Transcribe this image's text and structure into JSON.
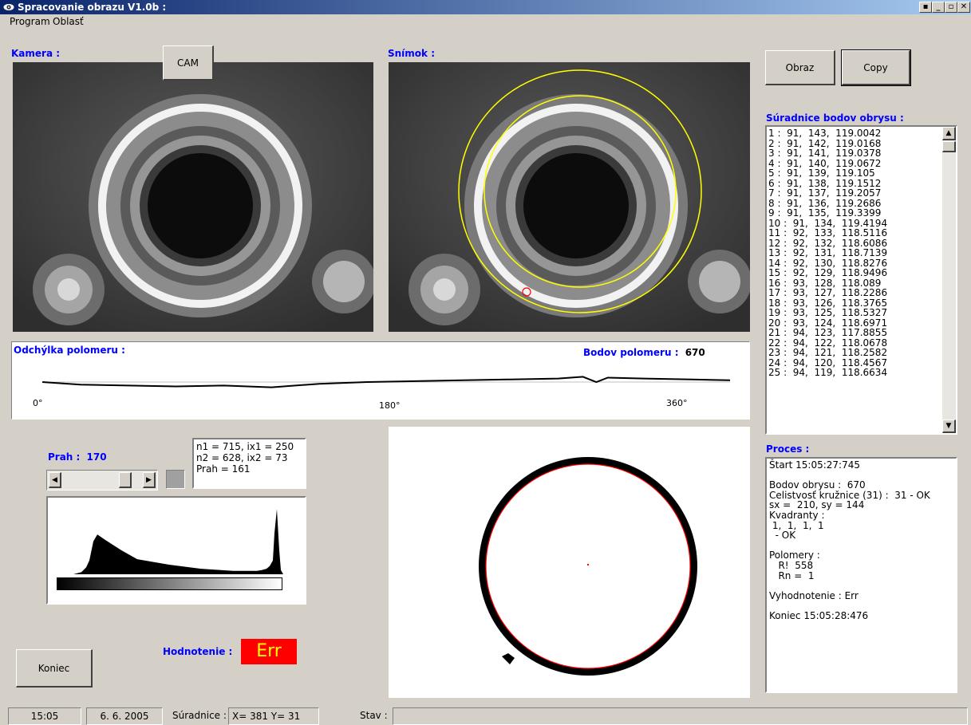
{
  "window": {
    "title": "Spracovanie obrazu V1.0b :",
    "controls": [
      "▪",
      "_",
      "▫",
      "✕"
    ]
  },
  "menu": {
    "items": [
      "Program",
      "Oblasť"
    ]
  },
  "camera": {
    "label": "Kamera :",
    "cam_button": "CAM"
  },
  "snapshot": {
    "label": "Snímok :"
  },
  "buttons": {
    "obraz": "Obraz",
    "copy": "Copy",
    "koniec": "Koniec"
  },
  "coords": {
    "label": "Súradnice bodov obrysu :",
    "items": [
      "1 :  91,  143,  119.0042",
      "2 :  91,  142,  119.0168",
      "3 :  91,  141,  119.0378",
      "4 :  91,  140,  119.0672",
      "5 :  91,  139,  119.105",
      "6 :  91,  138,  119.1512",
      "7 :  91,  137,  119.2057",
      "8 :  91,  136,  119.2686",
      "9 :  91,  135,  119.3399",
      "10 :  91,  134,  119.4194",
      "11 :  92,  133,  118.5116",
      "12 :  92,  132,  118.6086",
      "13 :  92,  131,  118.7139",
      "14 :  92,  130,  118.8276",
      "15 :  92,  129,  118.9496",
      "16 :  93,  128,  118.089",
      "17 :  93,  127,  118.2286",
      "18 :  93,  126,  118.3765",
      "19 :  93,  125,  118.5327",
      "20 :  93,  124,  118.6971",
      "21 :  94,  123,  117.8855",
      "22 :  94,  122,  118.0678",
      "23 :  94,  121,  118.2582",
      "24 :  94,  120,  118.4567",
      "25 :  94,  119,  118.6634"
    ]
  },
  "deviation": {
    "label": "Odchýlka polomeru :",
    "points_label": "Bodov polomeru :",
    "points_value": "670",
    "axis_ticks": [
      "0°",
      "180°",
      "360°"
    ]
  },
  "threshold": {
    "label": "Prah :",
    "value": "170",
    "stats": [
      "n1 = 715, ix1 = 250",
      "n2 = 628, ix2 = 73",
      "Prah = 161"
    ]
  },
  "evaluation": {
    "label": "Hodnotenie :",
    "result": "Err"
  },
  "process": {
    "label": "Proces :",
    "lines": [
      "Štart 15:05:27:745",
      "",
      "Bodov obrysu :  670",
      "Celistvosť kružnice (31) :  31 - OK",
      "sx =  210, sy = 144",
      "Kvadranty :",
      " 1,  1,  1,  1",
      "  - OK",
      "",
      "Polomery :",
      "   R!  558",
      "   Rn =  1",
      "",
      "Vyhodnotenie : Err",
      "",
      "Koniec 15:05:28:476"
    ]
  },
  "status": {
    "time": "15:05",
    "date": "6. 6. 2005",
    "coords_label": "Súradnice :",
    "coords_value": "X= 381 Y= 31",
    "state_label": "Stav :"
  },
  "colors": {
    "title_blue": "#0a246a",
    "label_blue": "#0000ff",
    "err_red": "#ff0000",
    "err_text": "#ffff00",
    "ring_yellow": "#ffff00",
    "contour_red": "#ff0000"
  },
  "chart_data": [
    {
      "type": "line",
      "x": [
        0,
        20,
        45,
        70,
        95,
        120,
        145,
        170,
        195,
        220,
        245,
        270,
        283,
        290,
        296,
        315,
        340,
        360
      ],
      "y": [
        0,
        -3,
        -4,
        -5,
        -4,
        -6,
        -2,
        0,
        1,
        2,
        3,
        4,
        6,
        0,
        5,
        4,
        3,
        2
      ],
      "xlim": [
        0,
        360
      ],
      "xticks": [
        "0°",
        "180°",
        "360°"
      ],
      "title": "Odchýlka polomeru :"
    },
    {
      "type": "area",
      "x": [
        0,
        20,
        30,
        36,
        40,
        45,
        50,
        60,
        80,
        100,
        140,
        180,
        220,
        250,
        256,
        262,
        266,
        270,
        272,
        275,
        278,
        280,
        283
      ],
      "y": [
        0,
        0,
        3,
        10,
        20,
        48,
        58,
        50,
        35,
        22,
        14,
        8,
        5,
        5,
        6,
        8,
        12,
        20,
        60,
        95,
        35,
        6,
        0
      ],
      "xlim": [
        0,
        283
      ],
      "ylim": [
        0,
        100
      ],
      "title": "Prah :  170"
    }
  ]
}
